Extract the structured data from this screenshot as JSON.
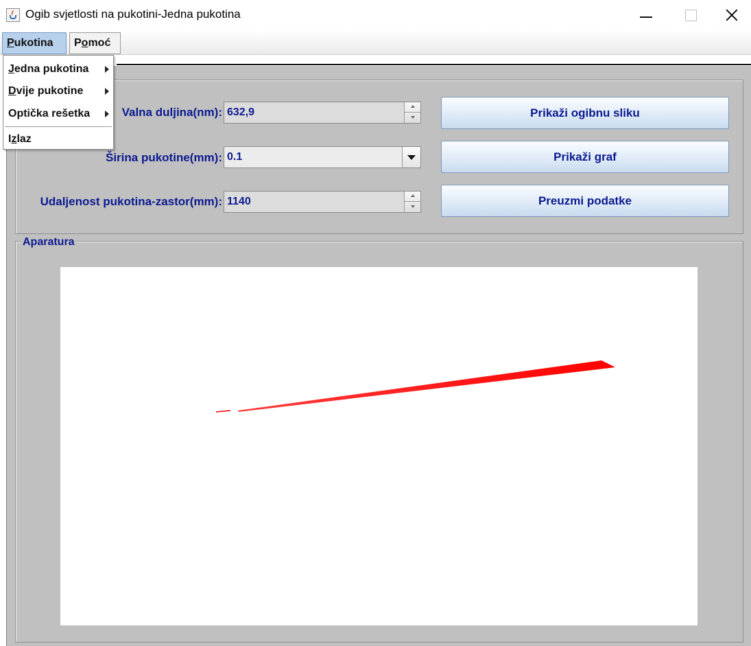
{
  "window": {
    "title": "Ogib svjetlosti na pukotini-Jedna pukotina"
  },
  "menubar": {
    "pukotina": {
      "first": "P",
      "rest": "ukotina"
    },
    "pomoc": {
      "pre": "P",
      "ul": "o",
      "post": "moć"
    }
  },
  "dropdown": {
    "items": [
      {
        "ul": "J",
        "rest": "edna pukotina",
        "submenu": true
      },
      {
        "ul": "D",
        "rest": "vije pukotine",
        "submenu": true
      },
      {
        "ul": "",
        "rest": "Optička rešetka",
        "submenu": true
      },
      {
        "pre": "I",
        "ul": "z",
        "rest": "laz",
        "submenu": false
      }
    ]
  },
  "params": {
    "wavelength_label": "Valna duljina(nm):",
    "wavelength_value": "632,9",
    "width_label": "Širina pukotine(mm):",
    "width_value": "0.1",
    "distance_label": "Udaljenost pukotina-zastor(mm):",
    "distance_value": "1140"
  },
  "buttons": {
    "show_pattern": "Prikaži ogibnu sliku",
    "show_graph": "Prikaži graf",
    "load_data": "Preuzmi podatke"
  },
  "apparatus": {
    "legend": "Aparatura",
    "beam_color": "#ff0000"
  }
}
